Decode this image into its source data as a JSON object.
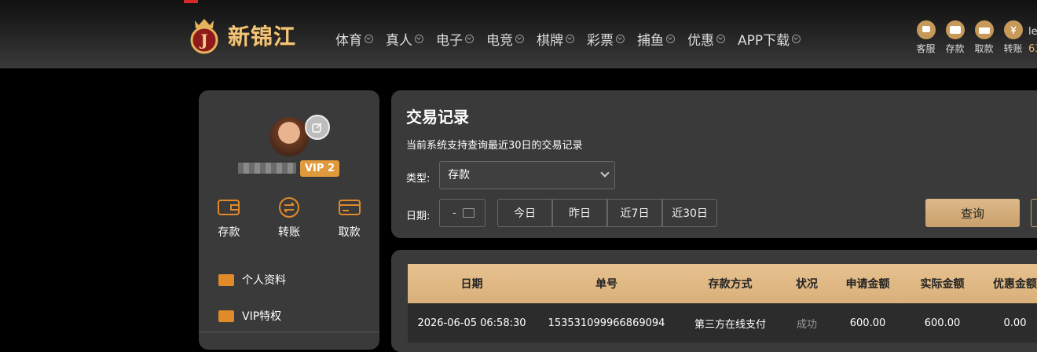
{
  "brand": {
    "name": "新锦江"
  },
  "nav": {
    "items": [
      "体育",
      "真人",
      "电子",
      "电竞",
      "棋牌",
      "彩票",
      "捕鱼",
      "优惠",
      "APP下载"
    ]
  },
  "quick_actions": [
    "客服",
    "存款",
    "取款",
    "转账"
  ],
  "user_cut": {
    "line1": "le",
    "line2": "63"
  },
  "profile": {
    "vip": "VIP 2"
  },
  "profile_actions": [
    "存款",
    "转账",
    "取款"
  ],
  "side_menu": [
    "个人资料",
    "VIP特权"
  ],
  "filter": {
    "title": "交易记录",
    "note": "当前系统支持查询最近30日的交易记录",
    "type_label": "类型:",
    "type_value": "存款",
    "date_label": "日期:",
    "date_value": "-",
    "ranges": [
      "今日",
      "昨日",
      "近7日",
      "近30日"
    ],
    "query_label": "查询"
  },
  "table": {
    "headers": [
      "日期",
      "单号",
      "存款方式",
      "状况",
      "申请金额",
      "实际金额",
      "优惠金额"
    ],
    "rows": [
      [
        "2026-06-05 06:58:30",
        "153531099966869094",
        "第三方在线支付",
        "成功",
        "600.00",
        "600.00",
        "0.00"
      ]
    ]
  },
  "colors": {
    "accent": "#d9b07a",
    "panel": "#3a3a3a",
    "vip": "#e09a3c"
  }
}
